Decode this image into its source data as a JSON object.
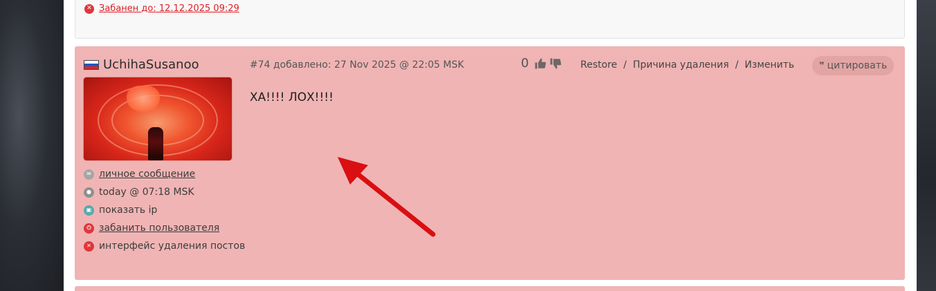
{
  "previous_post": {
    "ban_text": "Забанен до: 12.12.2025 09:29"
  },
  "post": {
    "author": {
      "name": "UchihaSusanoo",
      "flag": "ru-flag"
    },
    "meta": "#74 добавлено: 27 Nov 2025 @ 22:05 MSK",
    "rating": {
      "count": "0"
    },
    "actions": {
      "restore": "Restore",
      "delete_reason": "Причина удаления",
      "edit": "Изменить",
      "separator": "/"
    },
    "quote_label": "цитировать",
    "body": "ХА!!!! ЛОХ!!!!"
  },
  "side_links": {
    "private_message": "личное сообщение",
    "last_seen": "today @ 07:18 MSK",
    "show_ip": "показать ip",
    "ban_user": "забанить пользователя",
    "delete_posts": "интерфейс удаления постов"
  },
  "colors": {
    "post_background": "#f0b4b4",
    "ban_red": "#dd1f26",
    "arrow_red": "#d90f12"
  }
}
